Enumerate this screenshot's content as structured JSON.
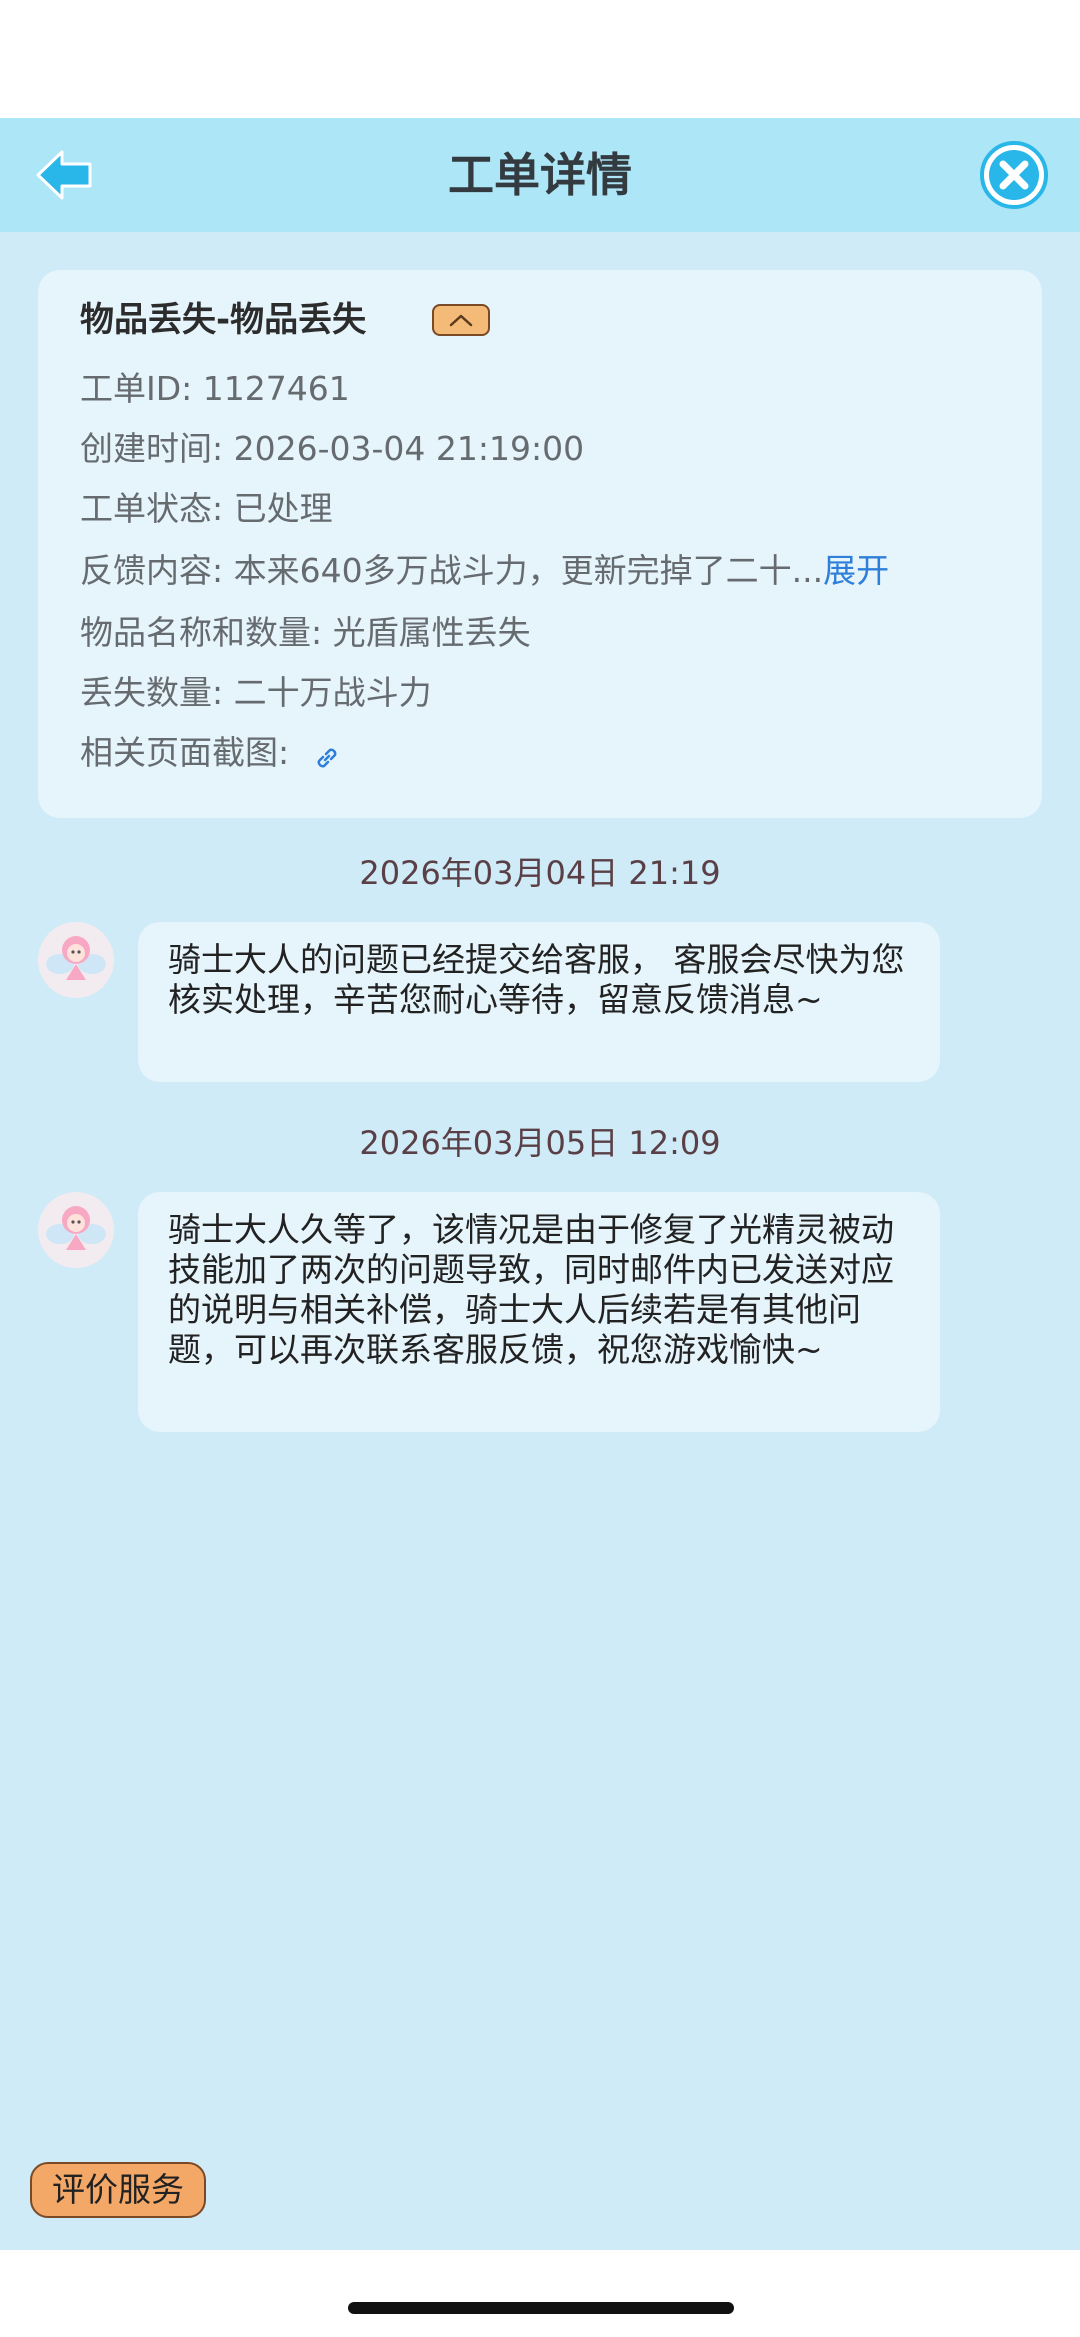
{
  "header": {
    "title": "工单详情",
    "back_icon": "arrow-left-icon",
    "close_icon": "close-circle-icon",
    "accent_color": "#29b6e8"
  },
  "card": {
    "title": "物品丢失-物品丢失",
    "collapse_icon": "chevron-up-icon",
    "rows": [
      {
        "text": "工单ID: 1127461"
      },
      {
        "text": "创建时间: 2026-03-04 21:19:00"
      },
      {
        "text": "工单状态: 已处理"
      },
      {
        "text": "反馈内容: 本来640多万战斗力，更新完掉了二十...",
        "link": "展开"
      },
      {
        "text": "物品名称和数量: 光盾属性丢失"
      },
      {
        "text": "丢失数量: 二十万战斗力"
      },
      {
        "text": "相关页面截图: ",
        "icon": "link-icon"
      }
    ]
  },
  "messages": [
    {
      "time": "2026年03月04日 21:19",
      "text": "骑士大人的问题已经提交给客服， 客服会尽快为您核实处理，辛苦您耐心等待，留意反馈消息~"
    },
    {
      "time": "2026年03月05日 12:09",
      "text": "骑士大人久等了，该情况是由于修复了光精灵被动技能加了两次的问题导致，同时邮件内已发送对应的说明与相关补偿，骑士大人后续若是有其他问题，可以再次联系客服反馈，祝您游戏愉快~"
    }
  ],
  "footer": {
    "rate_label": "评价服务"
  }
}
